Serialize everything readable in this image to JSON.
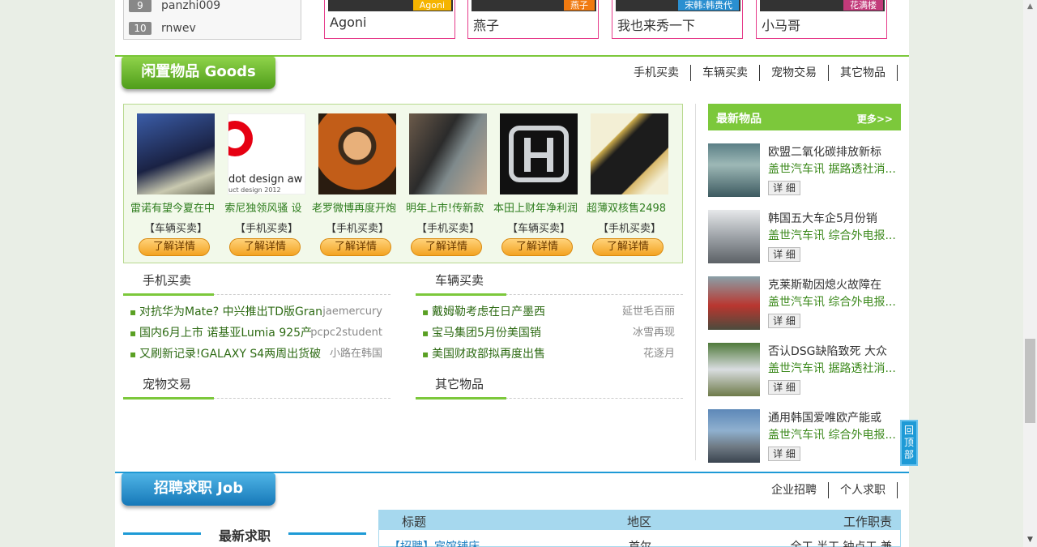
{
  "top": {
    "ranking": [
      {
        "num": "9",
        "name": "panzhi009"
      },
      {
        "num": "10",
        "name": "rnwev"
      }
    ],
    "show_cards": [
      {
        "tag": "Agoni",
        "tag_color": "#f5b400",
        "name": "Agoni"
      },
      {
        "tag": "燕子",
        "tag_color": "#f07a10",
        "name": "燕子"
      },
      {
        "tag": "宋韩:韩贵代",
        "tag_color": "#2a8fd0",
        "name": "我也来秀一下"
      },
      {
        "tag": "花满楼",
        "tag_color": "#c23a7a",
        "name": "小马哥"
      }
    ]
  },
  "goods": {
    "title": "闲置物品 Goods",
    "nav": [
      "手机买卖",
      "车辆买卖",
      "宠物交易",
      "其它物品"
    ],
    "items": [
      {
        "title": "雷诺有望今夏在中",
        "cat": "【车辆买卖】",
        "btn": "了解详情",
        "img": "conference-photo"
      },
      {
        "title": "索尼独领风骚 设",
        "cat": "【手机买卖】",
        "btn": "了解详情",
        "img": "red-dot-design-award"
      },
      {
        "title": "老罗微博再度开炮",
        "cat": "【手机买卖】",
        "btn": "了解详情",
        "img": "speaker-photo"
      },
      {
        "title": "明年上市!传新款",
        "cat": "【手机买卖】",
        "btn": "了解详情",
        "img": "iphone-hands-photo"
      },
      {
        "title": "本田上财年净利润",
        "cat": "【车辆买卖】",
        "btn": "了解详情",
        "img": "honda-logo-photo"
      },
      {
        "title": "超薄双核售2498",
        "cat": "【手机买卖】",
        "btn": "了解详情",
        "img": "phone-gold-photo"
      }
    ],
    "lists": {
      "phones": {
        "heading": "手机买卖",
        "rows": [
          {
            "title": "对抗华为Mate? 中兴推出TD版Gran",
            "user": "jaemercury"
          },
          {
            "title": "国内6月上市 诺基亚Lumia 925产",
            "user": "pcpc2student"
          },
          {
            "title": "又刷新记录!GALAXY S4两周出货破",
            "user": "小路在韩国"
          }
        ]
      },
      "cars": {
        "heading": "车辆买卖",
        "rows": [
          {
            "title": "戴姆勒考虑在日产墨西",
            "user": "延世毛百丽"
          },
          {
            "title": "宝马集团5月份美国销",
            "user": "冰雪再现"
          },
          {
            "title": "美国财政部拟再度出售",
            "user": "花逐月"
          }
        ]
      },
      "pets": {
        "heading": "宠物交易"
      },
      "others": {
        "heading": "其它物品"
      }
    }
  },
  "latest": {
    "heading": "最新物品",
    "more": "更多>>",
    "items": [
      {
        "t1": "欧盟二氧化碳排放新标",
        "t2": "盖世汽车讯 据路透社消...",
        "btn": "详 细"
      },
      {
        "t1": "韩国五大车企5月份销",
        "t2": "盖世汽车讯 综合外电报...",
        "btn": "详 细"
      },
      {
        "t1": "克莱斯勒因熄火故障在",
        "t2": "盖世汽车讯 综合外电报...",
        "btn": "详 细"
      },
      {
        "t1": "否认DSG缺陷致死 大众",
        "t2": "盖世汽车讯 据路透社消...",
        "btn": "详 细"
      },
      {
        "t1": "通用韩国爱唯欧产能或",
        "t2": "盖世汽车讯 综合外电报...",
        "btn": "详 细"
      }
    ]
  },
  "job": {
    "title": "招聘求职 Job",
    "nav": [
      "企业招聘",
      "个人求职"
    ],
    "sub_heading": "最新求职",
    "table": {
      "headers": [
        "标题",
        "地区",
        "工作职责"
      ],
      "row": [
        "【招聘】宾馆铺床",
        "首尔",
        "全工 半工 钟点工 兼"
      ]
    }
  },
  "back_to_top": "回顶部",
  "colors": {
    "goods_green": "#7cc83b",
    "job_blue": "#1e9ad6"
  }
}
